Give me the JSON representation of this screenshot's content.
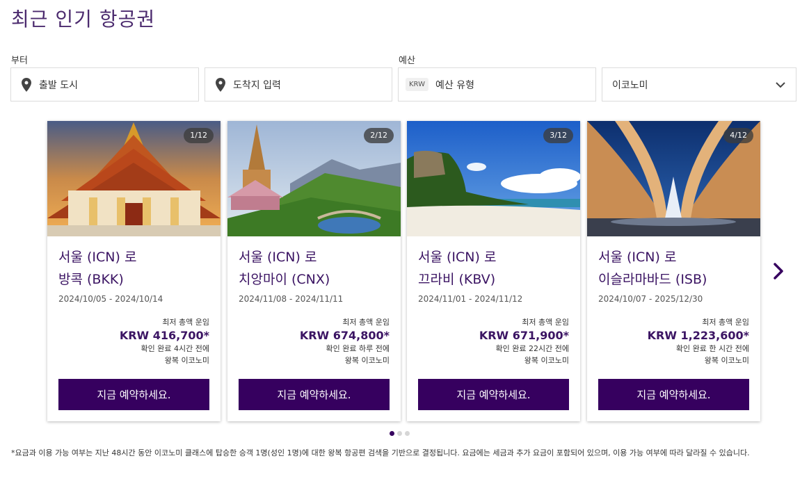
{
  "title": "최근 인기 항공권",
  "search": {
    "from_label": "부터",
    "from_placeholder": "출발 도시",
    "to_placeholder": "도착지 입력",
    "budget_label": "예산",
    "currency_badge": "KRW",
    "budget_placeholder": "예산 유형",
    "cabin_value": "이코노미"
  },
  "cards": [
    {
      "pager": "1/12",
      "line1": "서울 (ICN) 로",
      "line2": "방콕 (BKK)",
      "dates": "2024/10/05 - 2024/10/14",
      "price_label": "최저 총액 운임",
      "price": "KRW 416,700*",
      "checked": "확인 완료 4시간 전에",
      "trip": "왕복 이코노미",
      "button": "지금 예약하세요."
    },
    {
      "pager": "2/12",
      "line1": "서울 (ICN) 로",
      "line2": "치앙마이 (CNX)",
      "dates": "2024/11/08 - 2024/11/11",
      "price_label": "최저 총액 운임",
      "price": "KRW 674,800*",
      "checked": "확인 완료 하루 전에",
      "trip": "왕복 이코노미",
      "button": "지금 예약하세요."
    },
    {
      "pager": "3/12",
      "line1": "서울 (ICN) 로",
      "line2": "끄라비 (KBV)",
      "dates": "2024/11/01 - 2024/11/12",
      "price_label": "최저 총액 운임",
      "price": "KRW 671,900*",
      "checked": "확인 완료 22시간 전에",
      "trip": "왕복 이코노미",
      "button": "지금 예약하세요."
    },
    {
      "pager": "4/12",
      "line1": "서울 (ICN) 로",
      "line2": "이슬라마바드 (ISB)",
      "dates": "2024/10/07 - 2025/12/30",
      "price_label": "최저 총액 운임",
      "price": "KRW 1,223,600*",
      "checked": "확인 완료 한 시간 전에",
      "trip": "왕복 이코노미",
      "button": "지금 예약하세요."
    }
  ],
  "carousel": {
    "active_dot": 1,
    "dot_count": 3
  },
  "disclaimer": "*요금과 이용 가능 여부는 지난 48시간 동안 이코노미 클래스에 탑승한 승객 1명(성인 1명)에 대한 왕복 항공편 검색을 기반으로 결정됩니다. 요금에는 세금과 추가 요금이 포함되어 있으며, 이용 가능 여부에 따라 달라질 수 있습니다.",
  "colors": {
    "brand": "#36005f",
    "title": "#4b2a6e"
  },
  "icons": {
    "location": "map-pin-icon",
    "dropdown": "chevron-down-icon",
    "next": "chevron-right-icon"
  }
}
